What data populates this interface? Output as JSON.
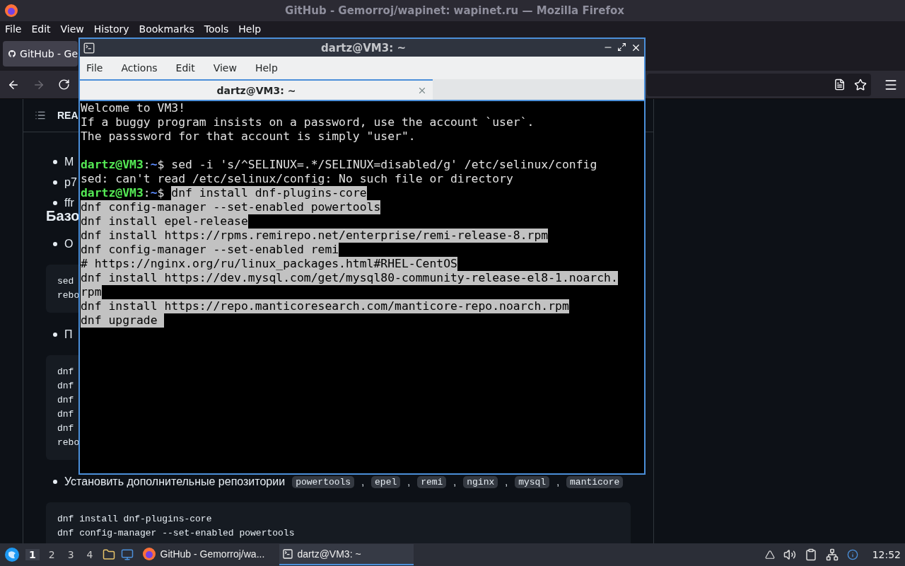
{
  "browser": {
    "title": "GitHub - Gemorroj/wapinet: wapinet.ru — Mozilla Firefox",
    "menu": [
      "File",
      "Edit",
      "View",
      "History",
      "Bookmarks",
      "Tools",
      "Help"
    ],
    "tabs": [
      {
        "label": "GitHub - Ge",
        "selected": true
      }
    ],
    "nav": {
      "forward_disabled": true
    }
  },
  "readme": {
    "header": "REA",
    "blocks": [
      {
        "kind": "bullet",
        "text": "M"
      },
      {
        "kind": "bullet",
        "text": "p7"
      },
      {
        "kind": "bullet",
        "text": "ffr"
      },
      {
        "kind": "heading",
        "text": "Базо"
      },
      {
        "kind": "bullet",
        "text": "О"
      },
      {
        "kind": "code",
        "lines": [
          "sed",
          "rebo"
        ]
      },
      {
        "kind": "bullet",
        "text": "П"
      },
      {
        "kind": "code",
        "lines": [
          "dnf",
          "dnf",
          "dnf",
          "dnf",
          "dnf",
          "rebo"
        ]
      },
      {
        "kind": "bullet",
        "text": "Установить дополнительные репозитории",
        "separator": ",",
        "chips": [
          "powertools",
          "epel",
          "remi",
          "nginx",
          "mysql",
          "manticore"
        ]
      },
      {
        "kind": "code",
        "lines": [
          "dnf install dnf-plugins-core",
          "dnf config-manager --set-enabled powertools"
        ]
      }
    ]
  },
  "terminal": {
    "title": "dartz@VM3: ~",
    "menu": [
      "File",
      "Actions",
      "Edit",
      "View",
      "Help"
    ],
    "tabs": [
      {
        "label": "dartz@VM3: ~",
        "selected": true
      }
    ],
    "lines": [
      {
        "kind": "output",
        "text": "Welcome to VM3!",
        "selected": false
      },
      {
        "kind": "output",
        "text": "If a buggy program insists on a password, use the account `user`.",
        "selected": false
      },
      {
        "kind": "output",
        "text": "The passsword for that account is simply \"user\".",
        "selected": false
      },
      {
        "kind": "blank"
      },
      {
        "kind": "command",
        "prompt": {
          "user": "dartz@VM3",
          "sep": ":",
          "path": "~",
          "symbol": "$"
        },
        "text": "sed -i 's/^SELINUX=.*/SELINUX=disabled/g' /etc/selinux/config",
        "selected": false
      },
      {
        "kind": "output",
        "text": "sed: can't read /etc/selinux/config: No such file or directory",
        "selected": false
      },
      {
        "kind": "command",
        "prompt": {
          "user": "dartz@VM3",
          "sep": ":",
          "path": "~",
          "symbol": "$"
        },
        "text": "dnf install dnf-plugins-core",
        "selected": true
      },
      {
        "kind": "output",
        "text": "dnf config-manager --set-enabled powertools",
        "selected": true
      },
      {
        "kind": "output",
        "text": "dnf install epel-release",
        "selected": true
      },
      {
        "kind": "output",
        "text": "dnf install https://rpms.remirepo.net/enterprise/remi-release-8.rpm",
        "selected": true
      },
      {
        "kind": "output",
        "text": "dnf config-manager --set-enabled remi",
        "selected": true
      },
      {
        "kind": "output",
        "text": "# https://nginx.org/ru/linux_packages.html#RHEL-CentOS",
        "selected": true
      },
      {
        "kind": "output",
        "text": "dnf install https://dev.mysql.com/get/mysql80-community-release-el8-1.noarch.",
        "selected": true
      },
      {
        "kind": "output",
        "text": "rpm",
        "selected": true
      },
      {
        "kind": "output",
        "text": "dnf install https://repo.manticoresearch.com/manticore-repo.noarch.rpm",
        "selected": true
      },
      {
        "kind": "output",
        "text": "dnf upgrade ",
        "selected": true
      }
    ]
  },
  "taskbar": {
    "workspaces": [
      {
        "label": "1",
        "selected": true
      },
      {
        "label": "2",
        "selected": false
      },
      {
        "label": "3",
        "selected": false
      },
      {
        "label": "4",
        "selected": false
      }
    ],
    "windows": [
      {
        "kind": "browser",
        "label": "GitHub - Gemorroj/wa...",
        "selected": false
      },
      {
        "kind": "terminal",
        "label": "dartz@VM3: ~",
        "selected": true
      }
    ],
    "clock": "12:52"
  }
}
